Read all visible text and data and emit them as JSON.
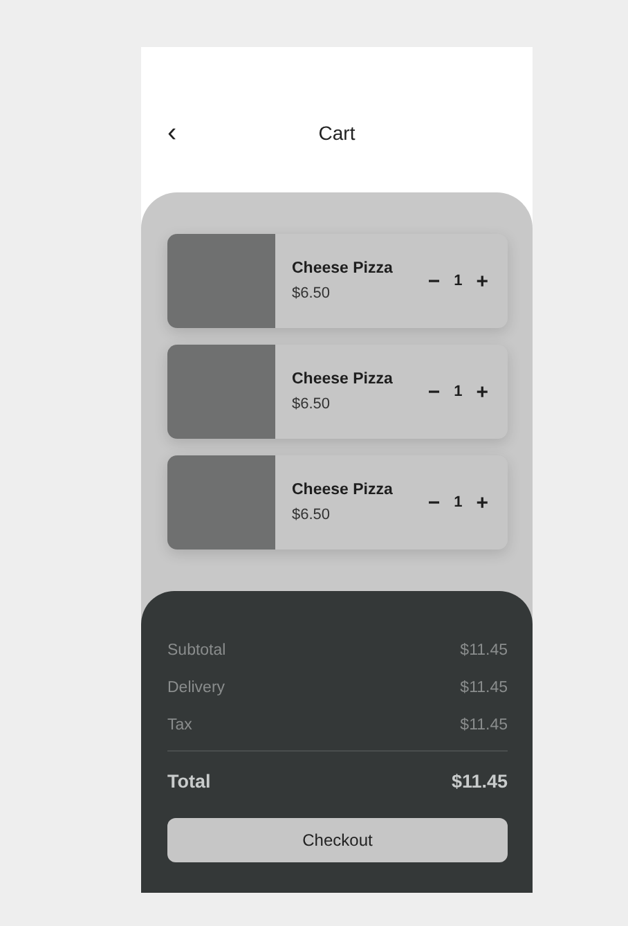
{
  "header": {
    "back": "‹",
    "title": "Cart"
  },
  "items": [
    {
      "name": "Cheese Pizza",
      "price": "$6.50",
      "decrease": "−",
      "quantity": "1",
      "increase": "+"
    },
    {
      "name": "Cheese Pizza",
      "price": "$6.50",
      "decrease": "−",
      "quantity": "1",
      "increase": "+"
    },
    {
      "name": "Cheese Pizza",
      "price": "$6.50",
      "decrease": "−",
      "quantity": "1",
      "increase": "+"
    }
  ],
  "summary": {
    "rows": [
      {
        "label": "Subtotal",
        "value": "$11.45"
      },
      {
        "label": "Delivery",
        "value": "$11.45"
      },
      {
        "label": "Tax",
        "value": "$11.45"
      }
    ],
    "total": {
      "label": "Total",
      "value": "$11.45"
    },
    "checkout": "Checkout"
  }
}
